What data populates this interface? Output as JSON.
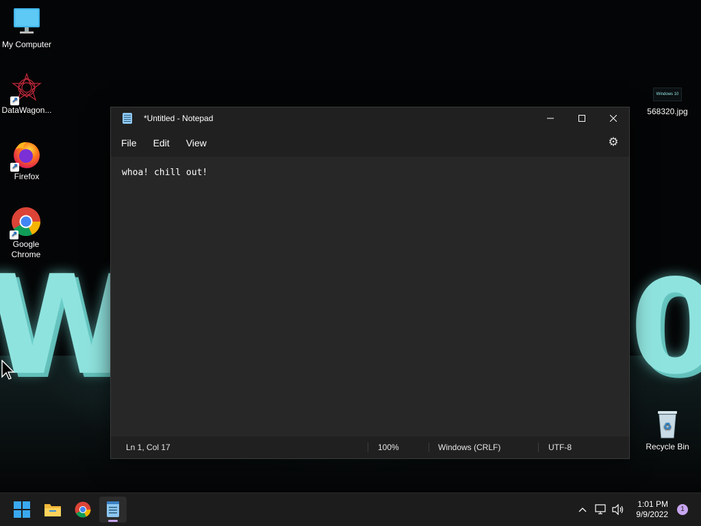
{
  "desktop": {
    "icons": [
      {
        "label": "My Computer",
        "icon": "monitor-icon"
      },
      {
        "label": "DataWagon...",
        "icon": "datawagon-icon"
      },
      {
        "label": "Firefox",
        "icon": "firefox-icon"
      },
      {
        "label": "Google Chrome",
        "icon": "chrome-icon"
      },
      {
        "label": "568320.jpg",
        "icon": "image-file-icon"
      },
      {
        "label": "Recycle Bin",
        "icon": "recycle-bin-icon"
      }
    ],
    "image_thumb_text": "Windows 10"
  },
  "notepad": {
    "title": "*Untitled - Notepad",
    "menu": [
      "File",
      "Edit",
      "View"
    ],
    "content": "whoa! chill out!",
    "status": {
      "position": "Ln 1, Col 17",
      "zoom": "100%",
      "line_ending": "Windows (CRLF)",
      "encoding": "UTF-8"
    }
  },
  "taskbar": {
    "clock_time": "1:01 PM",
    "clock_date": "9/9/2022",
    "notification_count": "1"
  },
  "colors": {
    "accent": "#c8a6f0",
    "wallpaper_glow": "#8fe3de",
    "window_bg": "#272727",
    "bar_bg": "#202020"
  }
}
